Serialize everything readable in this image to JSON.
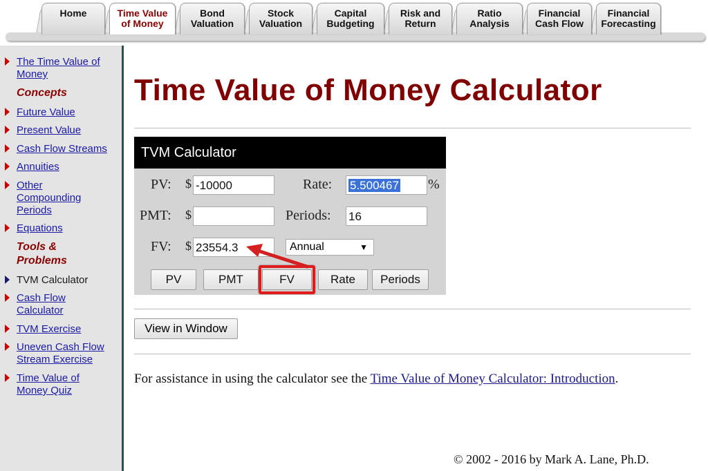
{
  "tabs": [
    {
      "label_1": "Home",
      "label_2": "",
      "active": false
    },
    {
      "label_1": "Time Value",
      "label_2": "of Money",
      "active": true
    },
    {
      "label_1": "Bond",
      "label_2": "Valuation",
      "active": false
    },
    {
      "label_1": "Stock",
      "label_2": "Valuation",
      "active": false
    },
    {
      "label_1": "Capital",
      "label_2": "Budgeting",
      "active": false
    },
    {
      "label_1": "Risk and",
      "label_2": "Return",
      "active": false
    },
    {
      "label_1": "Ratio",
      "label_2": "Analysis",
      "active": false
    },
    {
      "label_1": "Financial",
      "label_2": "Cash Flow",
      "active": false
    },
    {
      "label_1": "Financial",
      "label_2": "Forecasting",
      "active": false
    }
  ],
  "sidebar": {
    "intro": "The Time Value of Money",
    "concepts_heading": "Concepts",
    "concepts": [
      "Future Value",
      "Present Value",
      "Cash Flow Streams",
      "Annuities",
      "Other Compounding Periods",
      "Equations"
    ],
    "tools_heading": "Tools & Problems",
    "tools": [
      "TVM Calculator",
      "Cash Flow Calculator",
      "TVM Exercise",
      "Uneven Cash Flow Stream Exercise",
      "Time Value of Money Quiz"
    ]
  },
  "main": {
    "title": "Time Value of Money Calculator",
    "calculator": {
      "header": "TVM Calculator",
      "pv_label": "PV:",
      "pv_currency": "$",
      "pv_value": "-10000",
      "rate_label": "Rate:",
      "rate_value": "5.500467",
      "rate_unit": "%",
      "pmt_label": "PMT:",
      "pmt_currency": "$",
      "pmt_value": "",
      "periods_label": "Periods:",
      "periods_value": "16",
      "fv_label": "FV:",
      "fv_currency": "$",
      "fv_value": "23554.3",
      "compounding_selected": "Annual",
      "buttons": [
        "PV",
        "PMT",
        "FV",
        "Rate",
        "Periods"
      ]
    },
    "view_button": "View in Window",
    "assist_text": "For assistance in using the calculator see the ",
    "assist_link": "Time Value of Money Calculator: Introduction",
    "assist_end": ".",
    "copyright": "© 2002 - 2016 by Mark A. Lane, Ph.D."
  },
  "colors": {
    "title": "#800000",
    "highlight": "#e01b1b",
    "link": "#1a1aa6"
  }
}
